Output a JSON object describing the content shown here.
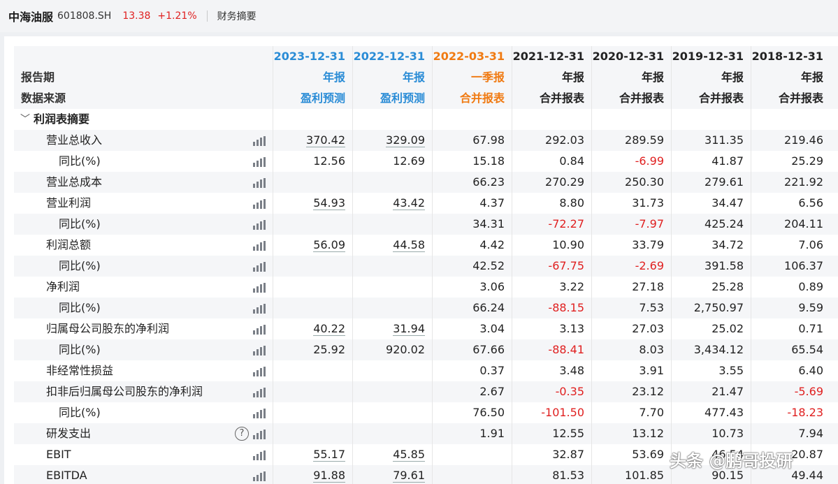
{
  "topbar": {
    "stock_name": "中海油服",
    "stock_code": "601808.SH",
    "price": "13.38",
    "change": "+1.21%",
    "tab": "财务摘要"
  },
  "header": {
    "period_label": "报告期",
    "source_label": "数据来源",
    "columns": [
      {
        "date": "2023-12-31",
        "type": "年报",
        "source": "盈利预测",
        "color": "#2a8cd6"
      },
      {
        "date": "2022-12-31",
        "type": "年报",
        "source": "盈利预测",
        "color": "#2a8cd6"
      },
      {
        "date": "2022-03-31",
        "type": "一季报",
        "source": "合并报表",
        "color": "#f07a12"
      },
      {
        "date": "2021-12-31",
        "type": "年报",
        "source": "合并报表",
        "color": "#222222"
      },
      {
        "date": "2020-12-31",
        "type": "年报",
        "source": "合并报表",
        "color": "#222222"
      },
      {
        "date": "2019-12-31",
        "type": "年报",
        "source": "合并报表",
        "color": "#222222"
      },
      {
        "date": "2018-12-31",
        "type": "年报",
        "source": "合并报表",
        "color": "#222222"
      }
    ]
  },
  "section": {
    "title": "利润表摘要",
    "icon": "chevron-down-icon"
  },
  "rows": [
    {
      "name": "营业总收入",
      "sub": false,
      "values": [
        "370.42",
        "329.09",
        "67.98",
        "292.03",
        "289.59",
        "311.35",
        "219.46"
      ]
    },
    {
      "name": "同比(%)",
      "sub": true,
      "values": [
        "12.56",
        "12.69",
        "15.18",
        "0.84",
        "-6.99",
        "41.87",
        "25.29"
      ]
    },
    {
      "name": "营业总成本",
      "sub": false,
      "values": [
        "",
        "",
        "66.23",
        "270.29",
        "250.30",
        "279.61",
        "221.92"
      ]
    },
    {
      "name": "营业利润",
      "sub": false,
      "values": [
        "54.93",
        "43.42",
        "4.37",
        "8.80",
        "31.73",
        "34.47",
        "6.56"
      ]
    },
    {
      "name": "同比(%)",
      "sub": true,
      "values": [
        "",
        "",
        "34.31",
        "-72.27",
        "-7.97",
        "425.24",
        "204.11"
      ]
    },
    {
      "name": "利润总额",
      "sub": false,
      "values": [
        "56.09",
        "44.58",
        "4.42",
        "10.90",
        "33.79",
        "34.72",
        "7.06"
      ]
    },
    {
      "name": "同比(%)",
      "sub": true,
      "values": [
        "",
        "",
        "42.52",
        "-67.75",
        "-2.69",
        "391.58",
        "106.37"
      ]
    },
    {
      "name": "净利润",
      "sub": false,
      "values": [
        "",
        "",
        "3.06",
        "3.22",
        "27.18",
        "25.28",
        "0.89"
      ]
    },
    {
      "name": "同比(%)",
      "sub": true,
      "values": [
        "",
        "",
        "66.24",
        "-88.15",
        "7.53",
        "2,750.97",
        "9.59"
      ]
    },
    {
      "name": "归属母公司股东的净利润",
      "sub": false,
      "values": [
        "40.22",
        "31.94",
        "3.04",
        "3.13",
        "27.03",
        "25.02",
        "0.71"
      ]
    },
    {
      "name": "同比(%)",
      "sub": true,
      "values": [
        "25.92",
        "920.02",
        "67.66",
        "-88.41",
        "8.03",
        "3,434.12",
        "65.54"
      ]
    },
    {
      "name": "非经常性损益",
      "sub": false,
      "values": [
        "",
        "",
        "0.37",
        "3.48",
        "3.91",
        "3.55",
        "6.40"
      ]
    },
    {
      "name": "扣非后归属母公司股东的净利润",
      "sub": false,
      "values": [
        "",
        "",
        "2.67",
        "-0.35",
        "23.12",
        "21.47",
        "-5.69"
      ]
    },
    {
      "name": "同比(%)",
      "sub": true,
      "values": [
        "",
        "",
        "76.50",
        "-101.50",
        "7.70",
        "477.43",
        "-18.23"
      ]
    },
    {
      "name": "研发支出",
      "sub": false,
      "help": true,
      "values": [
        "",
        "",
        "1.91",
        "12.55",
        "13.12",
        "10.73",
        "7.94"
      ]
    },
    {
      "name": "EBIT",
      "sub": false,
      "values": [
        "55.17",
        "45.85",
        "",
        "32.87",
        "53.69",
        "46.54",
        "20.87"
      ]
    },
    {
      "name": "EBITDA",
      "sub": false,
      "values": [
        "91.88",
        "79.61",
        "",
        "81.53",
        "101.85",
        "90.15",
        "49.44"
      ]
    }
  ],
  "watermark": "头条 @鹏哥投研",
  "colors": {
    "negative": "#e02020",
    "forecast": "#2a8cd6",
    "quarter": "#f07a12"
  }
}
